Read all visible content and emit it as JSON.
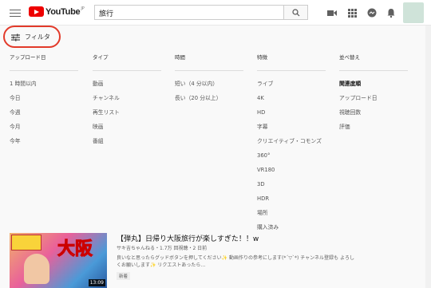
{
  "header": {
    "logo": "YouTube",
    "logo_sup": "JP",
    "search_value": "旅行"
  },
  "icons": {
    "menu": "hamburger-icon",
    "search": "search-icon",
    "upload": "video-camera-icon",
    "apps": "apps-grid-icon",
    "messages": "messages-icon",
    "notifications": "bell-icon"
  },
  "filter": {
    "label": "フィルタ"
  },
  "filters": [
    {
      "title": "アップロード日",
      "items": [
        "1 時間以内",
        "今日",
        "今週",
        "今月",
        "今年"
      ]
    },
    {
      "title": "タイプ",
      "items": [
        "動画",
        "チャンネル",
        "再生リスト",
        "映画",
        "番組"
      ]
    },
    {
      "title": "時間",
      "items": [
        "短い（4 分以内）",
        "長い（20 分以上）"
      ]
    },
    {
      "title": "特徴",
      "items": [
        "ライブ",
        "4K",
        "HD",
        "字幕",
        "クリエイティブ・コモンズ",
        "360°",
        "VR180",
        "3D",
        "HDR",
        "場所",
        "購入済み"
      ]
    },
    {
      "title": "並べ替え",
      "items": [
        "関連度順",
        "アップロード日",
        "視聴回数",
        "評価"
      ],
      "selected": 0
    }
  ],
  "video": {
    "title": "【弾丸】日帰り大阪旅行が楽しすぎた！！w",
    "meta": "サキ吉ちゃんねる・1.7万 回視聴・2 日前",
    "description": "良いなと思ったらグッドボタンを押してください✨ 動画作りの参考にします(*´▽`*) チャンネル登録も よろしくお願いします✨ リクエストあったら…",
    "badge": "新着",
    "duration": "13:09",
    "thumb_word": "大阪"
  },
  "colors": {
    "accent": "#e00000",
    "filter_highlight": "#e23a2a"
  }
}
